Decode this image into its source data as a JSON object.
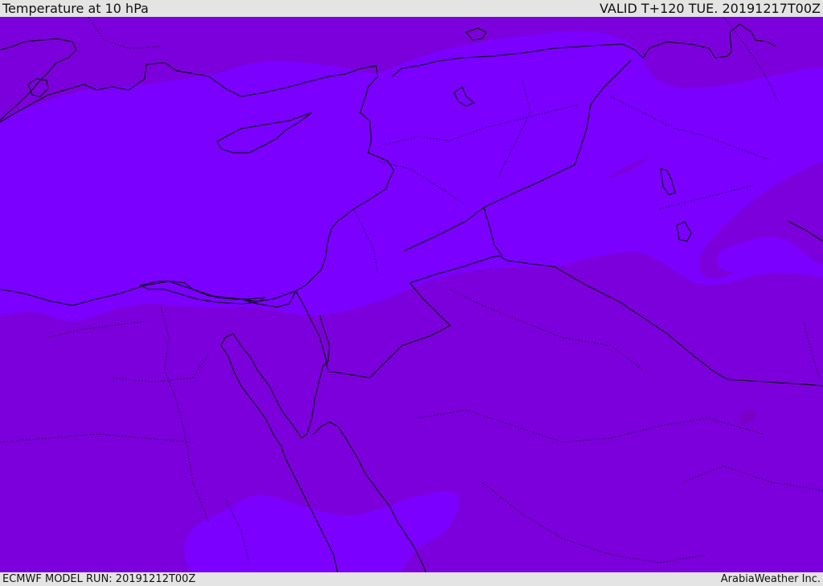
{
  "header": {
    "title": "Temperature at 10 hPa",
    "valid_time": "VALID T+120 TUE. 20191217T00Z"
  },
  "footer": {
    "model_run": "ECMWF MODEL RUN: 20191212T00Z",
    "credit": "ArabiaWeather Inc."
  },
  "map": {
    "colors": {
      "cold_band": "#7b00ff",
      "colder_band": "#7c00db",
      "coastline": "#000000",
      "border": "#000000"
    }
  }
}
